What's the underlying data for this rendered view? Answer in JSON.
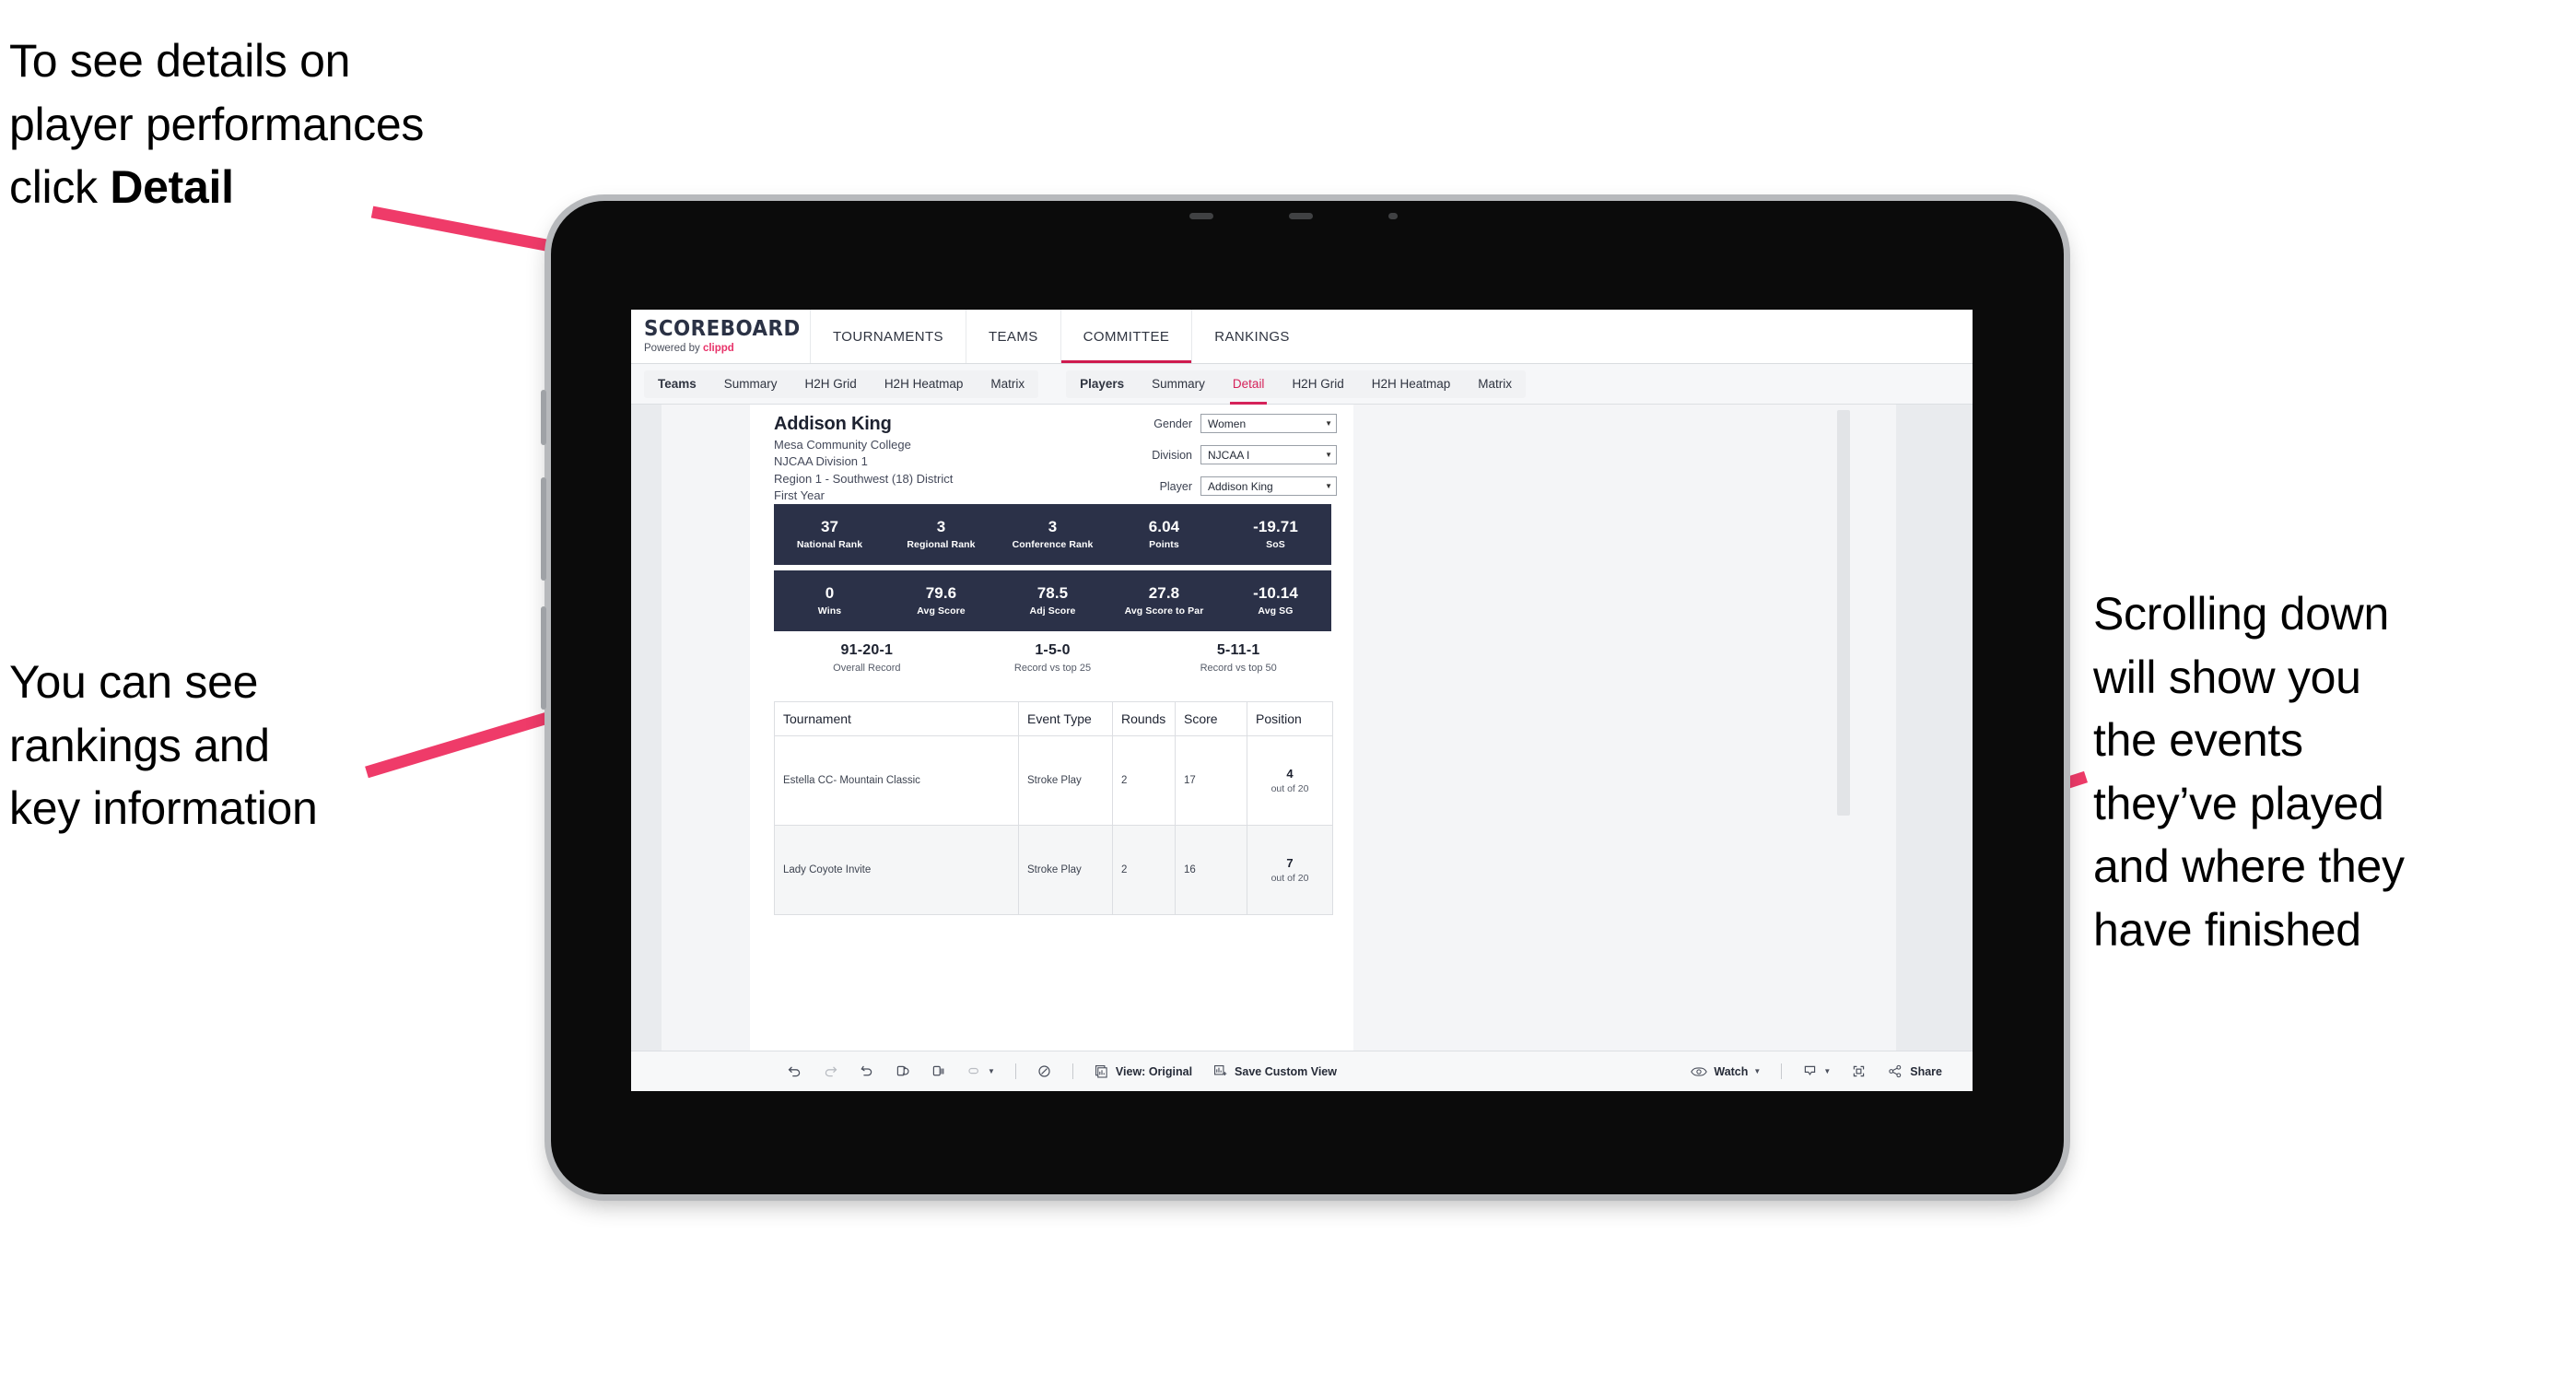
{
  "annotations": {
    "detail": "To see details on\nplayer performances\nclick ",
    "detail_bold": "Detail",
    "rankings": "You can see\nrankings and\nkey information",
    "scrolling": "Scrolling down\nwill show you\nthe events\nthey’ve played\nand where they\nhave finished"
  },
  "colors": {
    "accent_pink": "#ef3b69",
    "brand_pink": "#e8336a",
    "tab_active": "#d5225a",
    "stat_navy": "#2b3148",
    "page_bg": "#e9ebee"
  },
  "browser": {
    "brand": {
      "title": "SCOREBOARD",
      "subtitle_prefix": "Powered by ",
      "subtitle_brand": "clippd"
    },
    "topnav": [
      {
        "label": "TOURNAMENTS",
        "active": false
      },
      {
        "label": "TEAMS",
        "active": false
      },
      {
        "label": "COMMITTEE",
        "active": true
      },
      {
        "label": "RANKINGS",
        "active": false
      }
    ],
    "tabs_teams": [
      {
        "label": "Teams",
        "head": true,
        "selected": false
      },
      {
        "label": "Summary",
        "head": false,
        "selected": false
      },
      {
        "label": "H2H Grid",
        "head": false,
        "selected": false
      },
      {
        "label": "H2H Heatmap",
        "head": false,
        "selected": false
      },
      {
        "label": "Matrix",
        "head": false,
        "selected": false
      }
    ],
    "tabs_players": [
      {
        "label": "Players",
        "head": true,
        "selected": false
      },
      {
        "label": "Summary",
        "head": false,
        "selected": false
      },
      {
        "label": "Detail",
        "head": false,
        "selected": true
      },
      {
        "label": "H2H Grid",
        "head": false,
        "selected": false
      },
      {
        "label": "H2H Heatmap",
        "head": false,
        "selected": false
      },
      {
        "label": "Matrix",
        "head": false,
        "selected": false
      }
    ]
  },
  "player": {
    "name": "Addison King",
    "school": "Mesa Community College",
    "division": "NJCAA Division 1",
    "region": "Region 1 - Southwest (18) District",
    "year": "First Year"
  },
  "filters": [
    {
      "label": "Gender",
      "value": "Women"
    },
    {
      "label": "Division",
      "value": "NJCAA I"
    },
    {
      "label": "Player",
      "value": "Addison King"
    }
  ],
  "stats_row1": [
    {
      "value": "37",
      "label": "National Rank"
    },
    {
      "value": "3",
      "label": "Regional Rank"
    },
    {
      "value": "3",
      "label": "Conference Rank"
    },
    {
      "value": "6.04",
      "label": "Points"
    },
    {
      "value": "-19.71",
      "label": "SoS"
    }
  ],
  "stats_row2": [
    {
      "value": "0",
      "label": "Wins"
    },
    {
      "value": "79.6",
      "label": "Avg Score"
    },
    {
      "value": "78.5",
      "label": "Adj Score"
    },
    {
      "value": "27.8",
      "label": "Avg Score to Par"
    },
    {
      "value": "-10.14",
      "label": "Avg SG"
    }
  ],
  "records": [
    {
      "value": "91-20-1",
      "label": "Overall Record"
    },
    {
      "value": "1-5-0",
      "label": "Record vs top 25"
    },
    {
      "value": "5-11-1",
      "label": "Record vs top 50"
    }
  ],
  "table": {
    "headers": [
      "Tournament",
      "Event Type",
      "Rounds",
      "Score",
      "Position"
    ],
    "rows": [
      {
        "tournament": "Estella CC- Mountain Classic",
        "event_type": "Stroke Play",
        "rounds": "2",
        "score": "17",
        "position": "4",
        "position_of": "out of 20"
      },
      {
        "tournament": "Lady Coyote Invite",
        "event_type": "Stroke Play",
        "rounds": "2",
        "score": "16",
        "position": "7",
        "position_of": "out of 20"
      }
    ]
  },
  "toolbar": {
    "view_label": "View: Original",
    "save_label": "Save Custom View",
    "watch_label": "Watch",
    "share_label": "Share"
  }
}
